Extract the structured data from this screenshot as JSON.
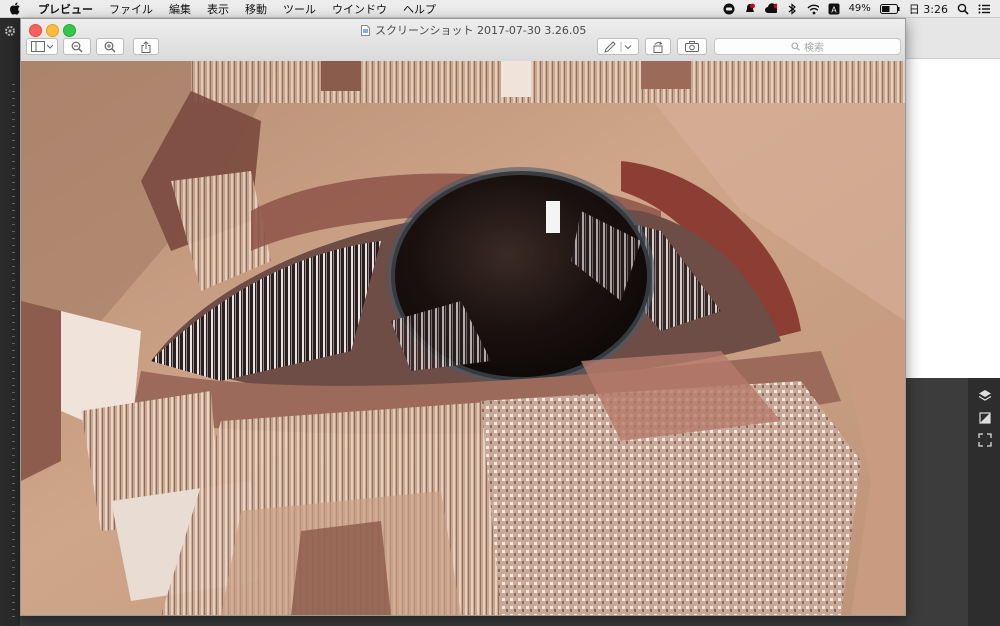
{
  "menubar": {
    "app_name": "プレビュー",
    "items": [
      "ファイル",
      "編集",
      "表示",
      "移動",
      "ツール",
      "ウインドウ",
      "ヘルプ"
    ],
    "battery_percent": "49%",
    "clock": "日 3:26",
    "status_icons": [
      "line-icon",
      "notification-icon",
      "creative-cloud-icon",
      "bluetooth-icon",
      "wifi-icon",
      "keyboard-input-icon",
      "battery-icon",
      "spotlight-icon",
      "notification-center-icon"
    ]
  },
  "window": {
    "title": "スクリーンショット 2017-07-30 3.26.05",
    "search_placeholder": "検索",
    "toolbar_icons": [
      "sidebar-toggle-icon",
      "zoom-out-icon",
      "zoom-in-icon",
      "share-icon",
      "markup-pen-icon",
      "rotate-icon",
      "camera-icon"
    ]
  },
  "colors": {
    "menubar_bg": "#ececec",
    "window_chrome": "#dadada",
    "skin": "#c79c80",
    "iris": "#1c1412"
  }
}
